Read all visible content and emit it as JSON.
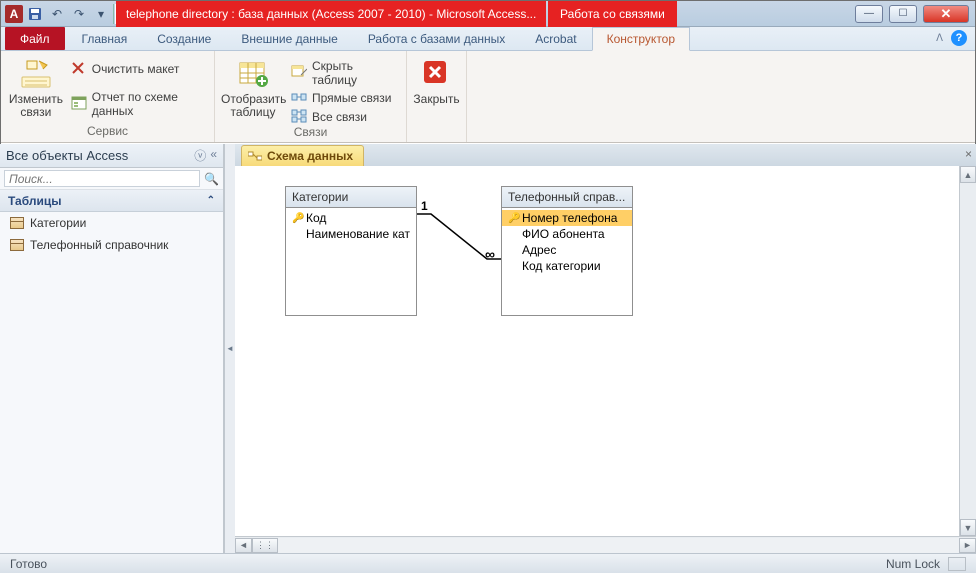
{
  "window": {
    "title": "telephone directory : база данных (Access 2007 - 2010)  -  Microsoft Access...",
    "context_tab": "Работа со связями"
  },
  "tabs": {
    "file": "Файл",
    "home": "Главная",
    "create": "Создание",
    "external": "Внешние данные",
    "dbtools": "Работа с базами данных",
    "acrobat": "Acrobat",
    "designer": "Конструктор"
  },
  "ribbon": {
    "group_service": "Сервис",
    "group_links": "Связи",
    "edit_links": "Изменить связи",
    "clear_layout": "Очистить макет",
    "schema_report": "Отчет по схеме данных",
    "show_table": "Отобразить таблицу",
    "hide_table": "Скрыть таблицу",
    "direct_links": "Прямые связи",
    "all_links": "Все связи",
    "close": "Закрыть"
  },
  "nav": {
    "title": "Все объекты Access",
    "search_placeholder": "Поиск...",
    "section_tables": "Таблицы",
    "items": [
      "Категории",
      "Телефонный справочник"
    ]
  },
  "doc": {
    "tab_title": "Схема данных",
    "table1": {
      "title": "Категории",
      "fields": [
        "Код",
        "Наименование кат"
      ]
    },
    "table2": {
      "title": "Телефонный справ...",
      "fields": [
        "Номер телефона",
        "ФИО абонента",
        "Адрес",
        "Код категории"
      ]
    },
    "rel_one": "1",
    "rel_many": "∞"
  },
  "status": {
    "ready": "Готово",
    "numlock": "Num Lock"
  }
}
